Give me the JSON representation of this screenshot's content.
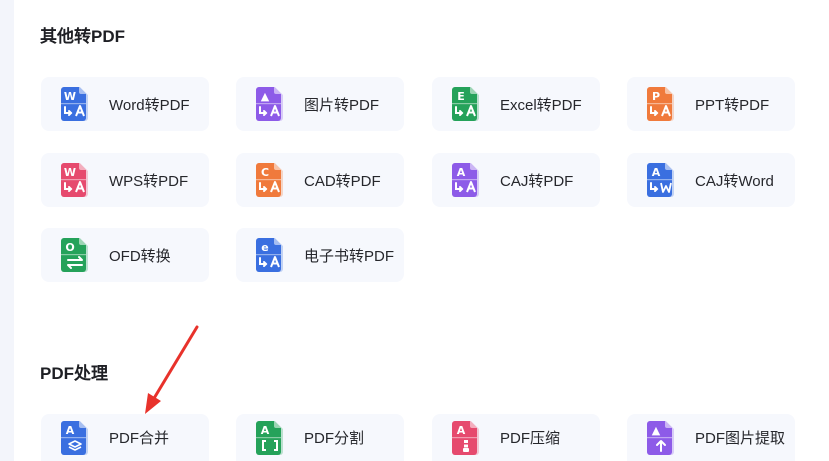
{
  "sections": [
    {
      "title": "其他转PDF",
      "tiles": [
        {
          "label": "Word转PDF",
          "letter": "W",
          "color": "#3a6fe0",
          "bottom": "convert"
        },
        {
          "label": "图片转PDF",
          "letter": "▲",
          "color": "#8d5be8",
          "bottom": "convert"
        },
        {
          "label": "Excel转PDF",
          "letter": "E",
          "color": "#25a25a",
          "bottom": "convert"
        },
        {
          "label": "PPT转PDF",
          "letter": "P",
          "color": "#f07a3c",
          "bottom": "convert"
        },
        {
          "label": "WPS转PDF",
          "letter": "W",
          "color": "#e64a6e",
          "bottom": "convert"
        },
        {
          "label": "CAD转PDF",
          "letter": "C",
          "color": "#f07a3c",
          "bottom": "convert"
        },
        {
          "label": "CAJ转PDF",
          "letter": "A",
          "color": "#8d5be8",
          "bottom": "convert"
        },
        {
          "label": "CAJ转Word",
          "letter": "A",
          "color": "#3a6fe0",
          "bottom": "word"
        },
        {
          "label": "OFD转换",
          "letter": "O",
          "color": "#25a25a",
          "bottom": "swap"
        },
        {
          "label": "电子书转PDF",
          "letter": "e",
          "color": "#3a6fe0",
          "bottom": "convert"
        }
      ]
    },
    {
      "title": "PDF处理",
      "tiles": [
        {
          "label": "PDF合并",
          "letter": "A",
          "color": "#3a6fe0",
          "bottom": "merge"
        },
        {
          "label": "PDF分割",
          "letter": "A",
          "color": "#25a25a",
          "bottom": "split"
        },
        {
          "label": "PDF压缩",
          "letter": "A",
          "color": "#e64a6e",
          "bottom": "zip"
        },
        {
          "label": "PDF图片提取",
          "letter": "▲",
          "color": "#8d5be8",
          "bottom": "extract"
        }
      ]
    }
  ],
  "annotation": {
    "arrow_color": "#e8322b"
  }
}
